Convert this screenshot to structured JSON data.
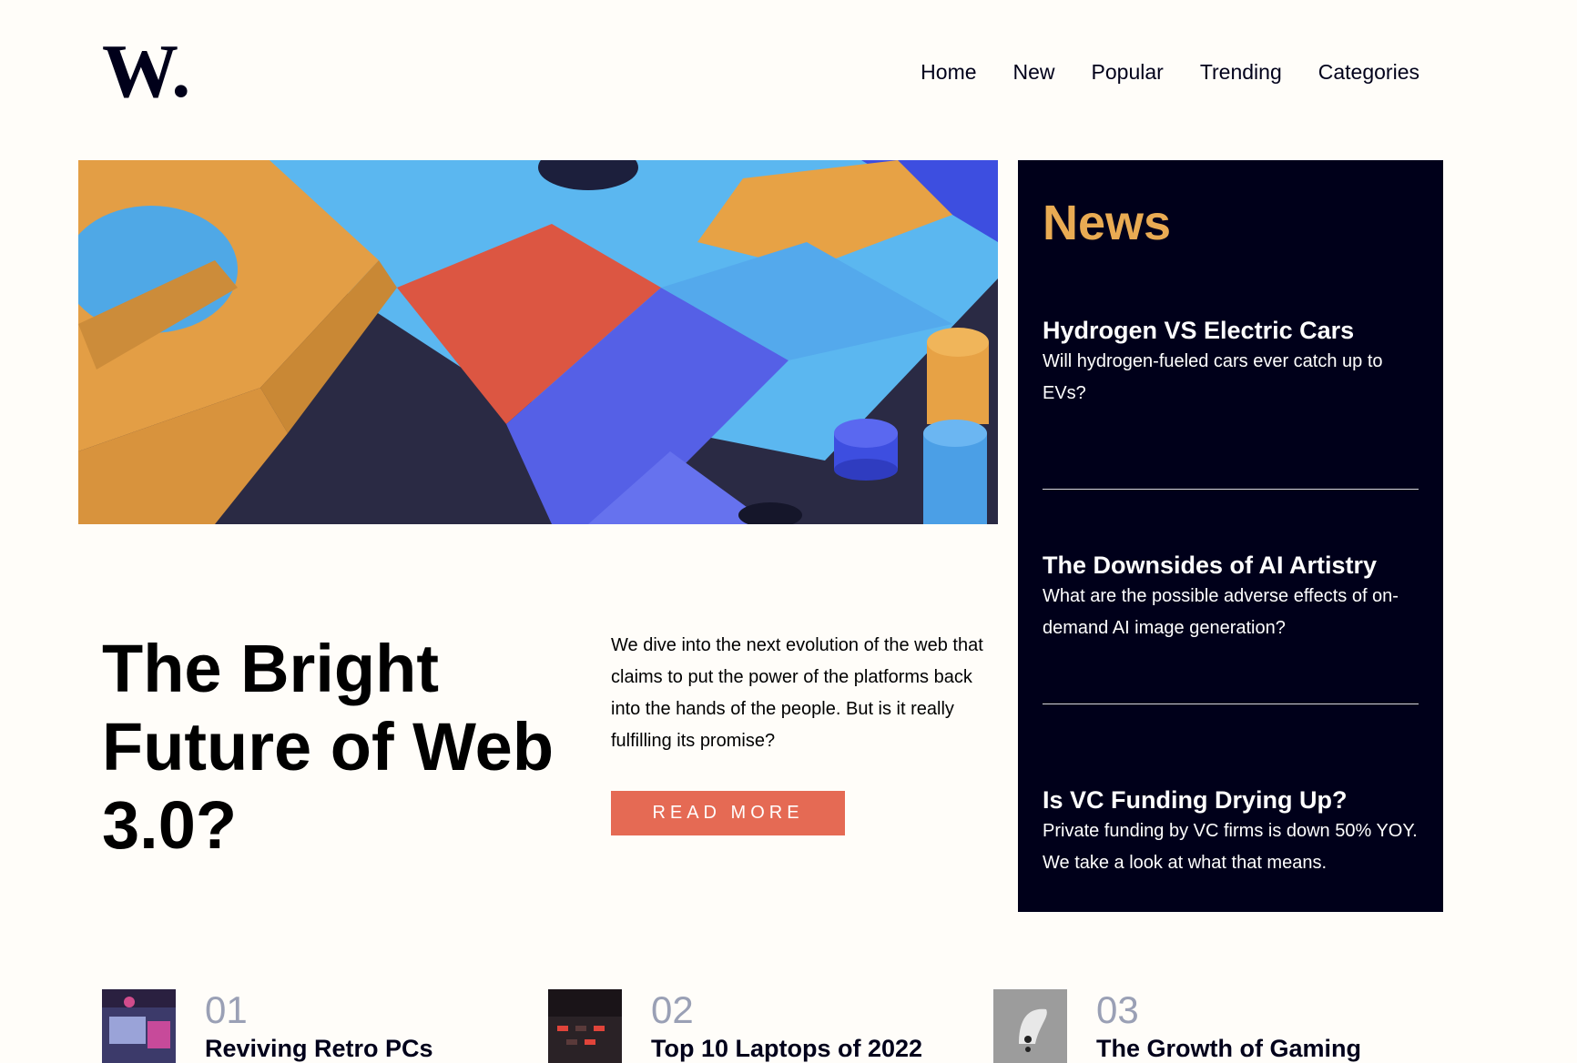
{
  "logo": {
    "text": "W."
  },
  "nav": {
    "items": [
      "Home",
      "New",
      "Popular",
      "Trending",
      "Categories"
    ]
  },
  "hero": {
    "title": "The Bright Future of Web 3.0?",
    "description": "We dive into the next evolution of the web that claims to put the power of the platforms back into the hands of the people. But is it really fulfilling its promise?",
    "button_label": "READ MORE"
  },
  "news": {
    "heading": "News",
    "items": [
      {
        "title": "Hydrogen VS Electric Cars",
        "summary": "Will hydrogen-fueled cars ever catch up to EVs?"
      },
      {
        "title": "The Downsides of AI Artistry",
        "summary": "What are the possible adverse effects of on-demand AI image generation?"
      },
      {
        "title": "Is VC Funding Drying Up?",
        "summary": "Private funding by VC firms is down 50% YOY. We take a look at what that means."
      }
    ]
  },
  "bottom": {
    "items": [
      {
        "number": "01",
        "title": "Reviving Retro PCs"
      },
      {
        "number": "02",
        "title": "Top 10 Laptops of 2022"
      },
      {
        "number": "03",
        "title": "The Growth of Gaming"
      }
    ]
  },
  "colors": {
    "accent": "#e56a54",
    "news_bg": "#00001a",
    "news_heading": "#e9ab53",
    "page_bg": "#fffdf9"
  }
}
